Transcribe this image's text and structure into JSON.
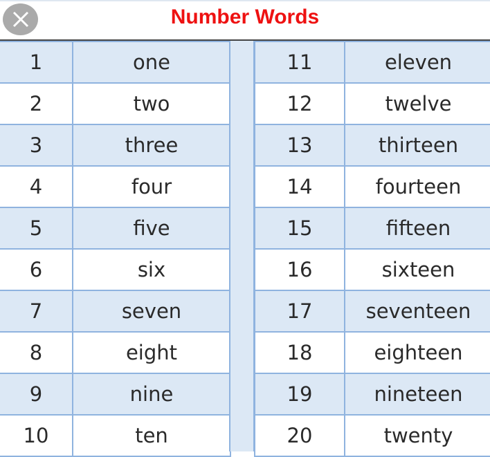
{
  "title": "Number Words",
  "close_icon": "close-icon",
  "left_rows": [
    {
      "number": "1",
      "word": "one"
    },
    {
      "number": "2",
      "word": "two"
    },
    {
      "number": "3",
      "word": "three"
    },
    {
      "number": "4",
      "word": "four"
    },
    {
      "number": "5",
      "word": "five"
    },
    {
      "number": "6",
      "word": "six"
    },
    {
      "number": "7",
      "word": "seven"
    },
    {
      "number": "8",
      "word": "eight"
    },
    {
      "number": "9",
      "word": "nine"
    },
    {
      "number": "10",
      "word": "ten"
    }
  ],
  "right_rows": [
    {
      "number": "11",
      "word": "eleven"
    },
    {
      "number": "12",
      "word": "twelve"
    },
    {
      "number": "13",
      "word": "thirteen"
    },
    {
      "number": "14",
      "word": "fourteen"
    },
    {
      "number": "15",
      "word": "fifteen"
    },
    {
      "number": "16",
      "word": "sixteen"
    },
    {
      "number": "17",
      "word": "seventeen"
    },
    {
      "number": "18",
      "word": "eighteen"
    },
    {
      "number": "19",
      "word": "nineteen"
    },
    {
      "number": "20",
      "word": "twenty"
    }
  ]
}
